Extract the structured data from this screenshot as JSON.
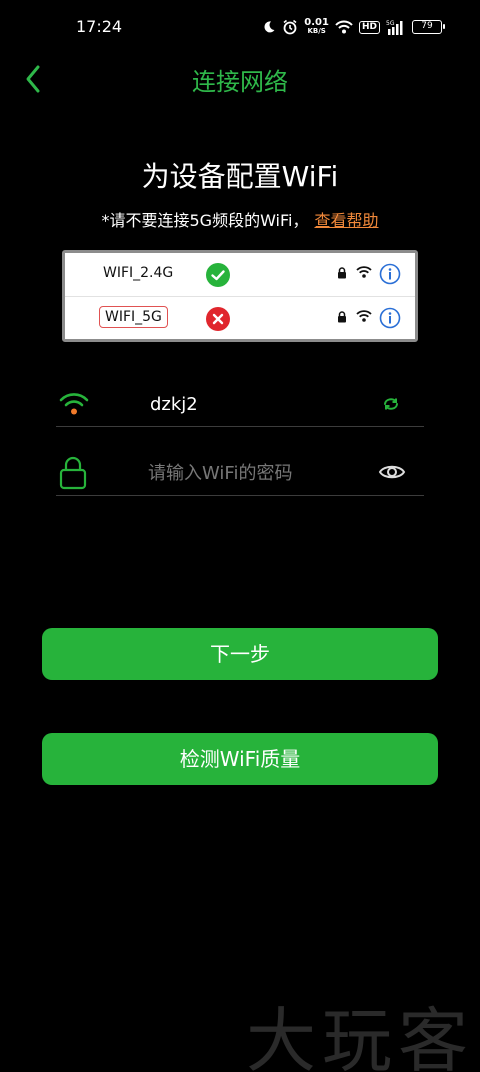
{
  "status_bar": {
    "time": "17:24",
    "net_speed_value": "0.01",
    "net_speed_unit": "KB/S",
    "hd_label": "HD",
    "signal_label": "5G",
    "battery": "79"
  },
  "nav": {
    "title": "连接网络",
    "back_icon": "chevron-left-icon",
    "accent_color": "#2fb84a"
  },
  "heading": "为设备配置WiFi",
  "hint": {
    "text": "*请不要连接5G频段的WiFi，",
    "link": "查看帮助",
    "link_color": "#f0883a"
  },
  "band_panel": {
    "rows": [
      {
        "name": "WIFI_2.4G",
        "status": "supported",
        "status_icon": "check-icon"
      },
      {
        "name": "WIFI_5G",
        "status": "unsupported",
        "status_icon": "close-icon"
      }
    ]
  },
  "form": {
    "ssid_value": "dzkj2",
    "password_placeholder": "请输入WiFi的密码"
  },
  "buttons": {
    "next": "下一步",
    "check_quality": "检测WiFi质量",
    "color": "#27b33b"
  },
  "watermark": "大玩客"
}
